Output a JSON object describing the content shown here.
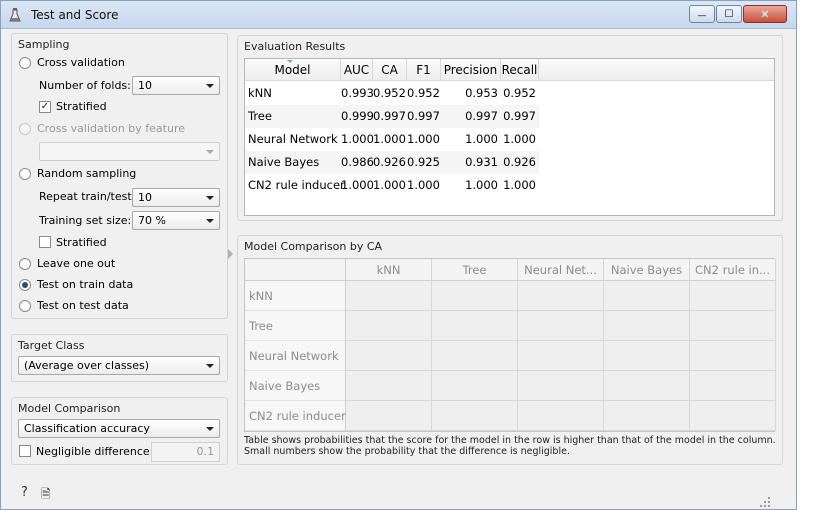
{
  "window": {
    "title": "Test and Score",
    "minimize_glyph": "—",
    "maximize_glyph": "☐",
    "close_glyph": "✕"
  },
  "sampling": {
    "title": "Sampling",
    "cross_validation": "Cross validation",
    "folds_label": "Number of folds:",
    "folds_value": "10",
    "stratified_label": "Stratified",
    "stratified_checked": true,
    "cv_by_feature": "Cross validation by feature",
    "feature_value": "",
    "random_sampling": "Random sampling",
    "repeat_label": "Repeat train/test:",
    "repeat_value": "10",
    "training_size_label": "Training set size:",
    "training_size_value": "70 %",
    "stratified2_label": "Stratified",
    "stratified2_checked": false,
    "leave_one_out": "Leave one out",
    "test_on_train": "Test on train data",
    "test_on_test": "Test on test data",
    "selected": "test_on_train"
  },
  "target_class": {
    "title": "Target Class",
    "value": "(Average over classes)"
  },
  "model_comparison": {
    "title": "Model Comparison",
    "metric": "Classification accuracy",
    "negligible_label": "Negligible difference:",
    "negligible_checked": false,
    "negligible_value": "0.1"
  },
  "evaluation": {
    "title": "Evaluation Results",
    "columns": [
      "Model",
      "AUC",
      "CA",
      "F1",
      "Precision",
      "Recall"
    ],
    "rows": [
      [
        "kNN",
        "0.993",
        "0.952",
        "0.952",
        "0.953",
        "0.952"
      ],
      [
        "Tree",
        "0.999",
        "0.997",
        "0.997",
        "0.997",
        "0.997"
      ],
      [
        "Neural Network",
        "1.000",
        "1.000",
        "1.000",
        "1.000",
        "1.000"
      ],
      [
        "Naive Bayes",
        "0.986",
        "0.926",
        "0.925",
        "0.931",
        "0.926"
      ],
      [
        "CN2 rule inducer",
        "1.000",
        "1.000",
        "1.000",
        "1.000",
        "1.000"
      ]
    ]
  },
  "comparison": {
    "title": "Model Comparison by CA",
    "columns": [
      "kNN",
      "Tree",
      "Neural Net...",
      "Naive Bayes",
      "CN2 rule in..."
    ],
    "rows": [
      "kNN",
      "Tree",
      "Neural Network",
      "Naive Bayes",
      "CN2 rule inducer"
    ],
    "footnote": "Table shows probabilities that the score for the model in the row is higher than that of the model in the column. Small numbers show the probability that the difference is negligible."
  },
  "footer": {
    "help_glyph": "?",
    "report_glyph": "🗎"
  },
  "colors": {
    "radio_dot": "#2c4e7c",
    "titlebar": "#c6d7ec"
  }
}
